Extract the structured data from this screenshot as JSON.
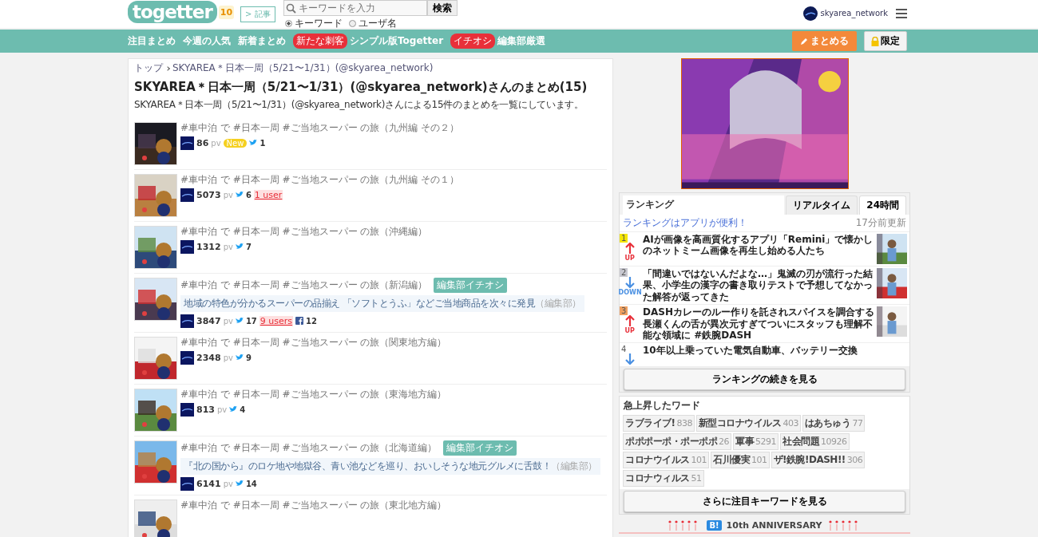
{
  "header": {
    "logo": "togetter",
    "logo_badge": "10",
    "article_button": "> 記事",
    "search": {
      "placeholder": "キーワードを入力",
      "button": "検索",
      "modes": [
        {
          "label": "キーワード",
          "selected": true
        },
        {
          "label": "ユーザ名",
          "selected": false
        }
      ]
    },
    "user": "skyarea_network"
  },
  "nav": {
    "items": [
      {
        "label": "注目まとめ"
      },
      {
        "label": "今週の人気"
      },
      {
        "label": "新着まとめ"
      },
      {
        "tag": "新たな刺客",
        "label": "シンプル版Togetter"
      },
      {
        "tag": "イチオシ",
        "label": "編集部厳選"
      }
    ],
    "create_button": "まとめる",
    "limited_button": "限定"
  },
  "breadcrumb": [
    {
      "label": "トップ"
    },
    {
      "label": "SKYAREA＊日本一周（5/21〜1/31）(@skyarea_network)"
    }
  ],
  "title": "SKYAREA＊日本一周（5/21〜1/31）(@skyarea_network)さんのまとめ(15)",
  "summary": "SKYAREA＊日本一周（5/21〜1/31）(@skyarea_network)さんによる15件のまとめを一覧にしています。",
  "articles": [
    {
      "title": "#車中泊 で #日本一周 #ご当地スーパー の旅（九州編 その２）",
      "pv": "86",
      "pv_unit": "pv",
      "new": "New",
      "tweets": "1"
    },
    {
      "title": "#車中泊 で #日本一周 #ご当地スーパー の旅（九州編 その１）",
      "pv": "5073",
      "pv_unit": "pv",
      "tweets": "6",
      "users": "1 user"
    },
    {
      "title": "#車中泊 で #日本一周 #ご当地スーパー の旅（沖縄編）",
      "pv": "1312",
      "pv_unit": "pv",
      "tweets": "7"
    },
    {
      "title": "#車中泊 で #日本一周 #ご当地スーパー の旅（新潟編）",
      "pick": "編集部イチオシ",
      "description": "地域の特色が分かるスーパーの品揃え 「ソフトとうふ」などご当地商品を次々に発見",
      "credit": "（編集部）",
      "pv": "3847",
      "pv_unit": "pv",
      "tweets": "17",
      "users": "9 users",
      "facebook": "12"
    },
    {
      "title": "#車中泊 で #日本一周 #ご当地スーパー の旅（関東地方編）",
      "pv": "2348",
      "pv_unit": "pv",
      "tweets": "9"
    },
    {
      "title": "#車中泊 で #日本一周 #ご当地スーパー の旅（東海地方編）",
      "pv": "813",
      "pv_unit": "pv",
      "tweets": "4"
    },
    {
      "title": "#車中泊 で #日本一周 #ご当地スーパー の旅（北海道編）",
      "pick": "編集部イチオシ",
      "description": "『北の国から』のロケ地や地獄谷、青い池などを巡り、おいしそうな地元グルメに舌鼓！",
      "credit": "（編集部）",
      "pv": "6141",
      "pv_unit": "pv",
      "tweets": "14"
    },
    {
      "title": "#車中泊 で #日本一周 #ご当地スーパー の旅（東北地方編）"
    }
  ],
  "ranking": {
    "heading": "ランキング",
    "tabs": [
      {
        "label": "リアルタイム",
        "selected": false
      },
      {
        "label": "24時間",
        "selected": true
      }
    ],
    "app_link": "ランキングはアプリが便利！",
    "updated": "17分前更新",
    "items": [
      {
        "rank": "1",
        "color": "#f5e600",
        "kind": "up",
        "move": "UP",
        "text": "AIが画像を高画質化するアプリ「Remini」で懐かしのネットミーム画像を再生し始める人たち"
      },
      {
        "rank": "2",
        "color": "#c8c8d0",
        "kind": "down",
        "move": "DOWN",
        "text": "「間違いではないんだよな…」鬼滅の刃が流行った結果、小学生の漢字の書き取りテストで予想してなかった解答が返ってきた"
      },
      {
        "rank": "3",
        "color": "#f0a060",
        "kind": "up",
        "move": "UP",
        "text": "DASHカレーのルー作りを託されスパイスを調合する長瀬くんの舌が異次元すぎてついにスタッフも理解不能な領域に #鉄腕DASH"
      },
      {
        "rank": "4",
        "color": "#ffffff",
        "kind": "down",
        "text": "10年以上乗っていた電気自動車、バッテリー交換"
      }
    ],
    "more_button": "ランキングの続きを見る"
  },
  "keywords": {
    "heading": "急上昇したワード",
    "items": [
      {
        "word": "ラブライブ!",
        "count": "838"
      },
      {
        "word": "新型コロナウイルス",
        "count": "403"
      },
      {
        "word": "はあちゅう",
        "count": "77"
      },
      {
        "word": "ポポポーポ・ポーポポ",
        "count": "26"
      },
      {
        "word": "軍事",
        "count": "5291"
      },
      {
        "word": "社会問題",
        "count": "10926"
      },
      {
        "word": "コロナウイルス",
        "count": "101"
      },
      {
        "word": "石川優実",
        "count": "101"
      },
      {
        "word": "ザ!鉄腕!DASH!!",
        "count": "306"
      },
      {
        "word": "コロナウィルス",
        "count": "51"
      }
    ],
    "more_button": "さらに注目キーワードを見る"
  },
  "anniversary": {
    "icon": "B!",
    "text": "10th ANNIVERSARY"
  }
}
